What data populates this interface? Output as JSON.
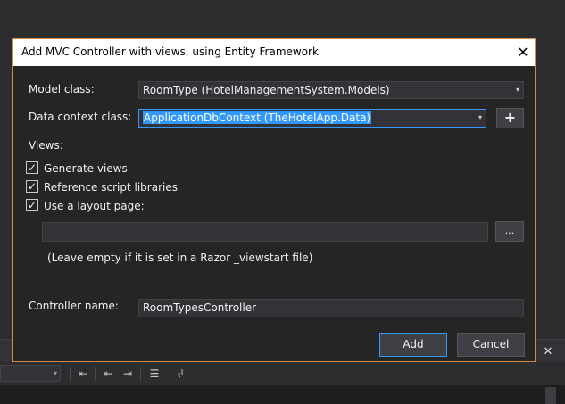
{
  "dialog": {
    "title": "Add MVC Controller with views, using Entity Framework",
    "model_class_label": "Model class:",
    "model_class_value": "RoomType (HotelManagementSystem.Models)",
    "data_context_label": "Data context class:",
    "data_context_value": "ApplicationDbContext (TheHotelApp.Data)",
    "add_context_glyph": "+",
    "views_label": "Views:",
    "options": [
      {
        "label": "Generate views",
        "checked": true
      },
      {
        "label": "Reference script libraries",
        "checked": true
      },
      {
        "label": "Use a layout page:",
        "checked": true
      }
    ],
    "layout_page_value": "",
    "browse_label": "...",
    "layout_hint": "(Leave empty if it is set in a Razor _viewstart file)",
    "controller_name_label": "Controller name:",
    "controller_name_value": "RoomTypesController",
    "add_button": "Add",
    "cancel_button": "Cancel",
    "close_glyph": "✕",
    "check_glyph": "✓",
    "dropdown_glyph": "▾"
  },
  "background": {
    "close_glyph": "✕",
    "accent_color": "#d58a3d",
    "selection_color": "#3399ff"
  }
}
